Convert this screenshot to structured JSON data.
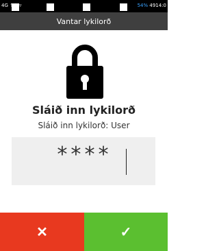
{
  "status_bar": {
    "left_text": "4G ↑↓ ▿",
    "battery": "54%",
    "time": "4914:0"
  },
  "title": "Vantar lykilorð",
  "heading": "Sláið inn lykilorð",
  "subheading": "Sláið inn lykilorð: User",
  "pin_value": "****",
  "buttons": {
    "cancel_icon": "✕",
    "confirm_icon": "✓"
  },
  "colors": {
    "cancel": "#e8391f",
    "confirm": "#5bbf30",
    "title_bar": "#3f3f3f"
  },
  "icons": [
    "lock-icon",
    "close-icon",
    "check-icon"
  ]
}
